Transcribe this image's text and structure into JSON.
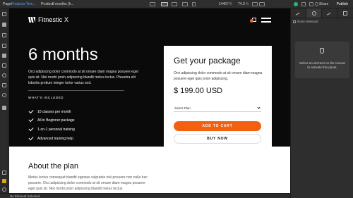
{
  "topbar": {
    "page_label": "Page:",
    "page_value": "Products Tem...",
    "product_label": "Product:",
    "product_value": "6 months (h...",
    "width_value": "1440",
    "width_unit": "PX",
    "zoom_value": "74.3",
    "zoom_unit": "%",
    "share_label": "Share",
    "publish_label": "Publish",
    "accent_color": "#4aa3ff"
  },
  "site": {
    "logo_text": "Fitnestic X",
    "hero_title": "6 months",
    "hero_description": "Orci adipiscing dolor commodo at sit ornare diam magna posuere eget quis sit. Nisi morbi proin adipiscing blandit metus lectus. Pharetra elit lobortis pretium integer tortor varius sed.",
    "included_heading": "WHAT'S INCLUDED",
    "included_items": [
      "10 classes per month",
      "All in Beginner package",
      "1-on-1 personal training",
      "Advanced training help"
    ],
    "card": {
      "title": "Get your package",
      "description": "Orci adipiscing dolor commodo at sit ornare diam magna posuere eget quis proin adipiscing.",
      "price": "$ 199.00 USD",
      "select_value": "Select Plan",
      "add_to_cart_label": "ADD TO CART",
      "buy_now_label": "BUY NOW",
      "accent_color": "#f26010"
    },
    "about_title": "About the plan",
    "about_description": "Metus lectus consequat blandit egestas vulputate nisl posuere non nulla hac posuere. Orci adipiscing dolor commodo at sit ornare diam magna posuere eget quis sit. Nisi morbi proin adipiscing blandit metus lectus."
  },
  "right_panel": {
    "none_selected": "None Selected",
    "empty_message": "Select an element on the canvas to activate this panel."
  },
  "status_bar": {
    "text": "No Element Selected"
  }
}
